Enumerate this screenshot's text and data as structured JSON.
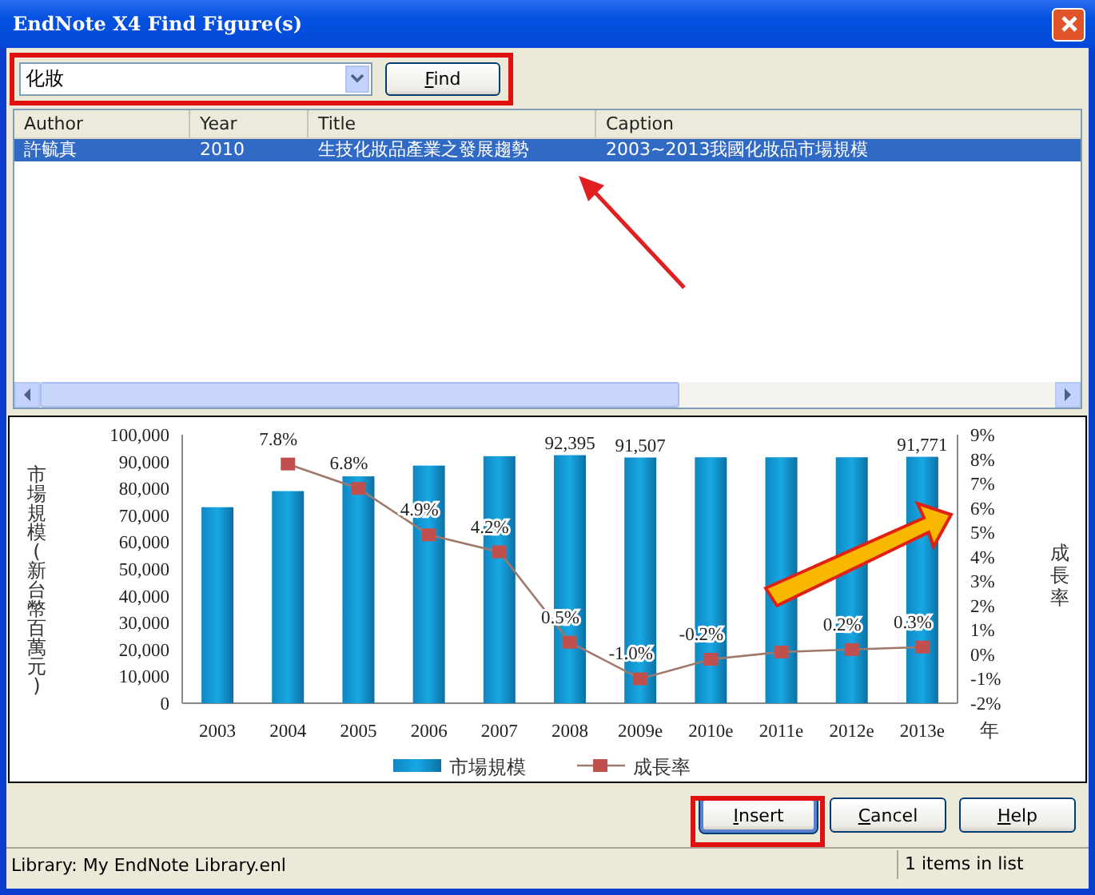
{
  "window": {
    "title": "EndNote X4 Find Figure(s)"
  },
  "search": {
    "value": "化妝",
    "button": "Find"
  },
  "results": {
    "columns": [
      "Author",
      "Year",
      "Title",
      "Caption"
    ],
    "rows": [
      {
        "cells": [
          "許毓真",
          "2010",
          "生技化妝品產業之發展趨勢",
          "2003~2013我國化妝品市場規模"
        ],
        "selected": true
      }
    ]
  },
  "preview": {
    "chart_data": {
      "type": "bar",
      "xlabel": "年",
      "ylabel": "市場規模(新台幣百萬元)",
      "categories": [
        "2003",
        "2004",
        "2005",
        "2006",
        "2007",
        "2008",
        "2009e",
        "2010e",
        "2011e",
        "2012e",
        "2013e"
      ],
      "series": [
        {
          "name": "市場規模",
          "color": "#18a8e4",
          "values": [
            73000,
            79000,
            84500,
            88500,
            92000,
            92395,
            91507,
            91600,
            91600,
            91600,
            91771
          ]
        }
      ],
      "value_labels": [
        null,
        null,
        null,
        null,
        null,
        "92,395",
        "91,507",
        null,
        null,
        null,
        "91,771"
      ],
      "ylim": [
        0,
        100000
      ],
      "yticks": [
        {
          "value": 0,
          "label": "0"
        },
        {
          "value": 10000,
          "label": "10,000"
        },
        {
          "value": 20000,
          "label": "20,000"
        },
        {
          "value": 30000,
          "label": "30,000"
        },
        {
          "value": 40000,
          "label": "40,000"
        },
        {
          "value": 50000,
          "label": "50,000"
        },
        {
          "value": 60000,
          "label": "60,000"
        },
        {
          "value": 70000,
          "label": "70,000"
        },
        {
          "value": 80000,
          "label": "80,000"
        },
        {
          "value": 90000,
          "label": "90,000"
        },
        {
          "value": 100000,
          "label": "100,000"
        }
      ]
    },
    "growth": {
      "chart_data": {
        "type": "line",
        "ylabel": "成長率",
        "categories": [
          null,
          null,
          null,
          null,
          null,
          null,
          null,
          null,
          null,
          null,
          null
        ],
        "series": [
          {
            "name": "成長率",
            "color": "#c0504d",
            "marker": "square",
            "values": [
              null,
              7.8,
              6.8,
              4.9,
              4.2,
              0.5,
              -1.0,
              -0.2,
              0.1,
              0.2,
              0.3
            ]
          }
        ],
        "ylim": [
          -2,
          9
        ],
        "yticks": [
          {
            "value": -2,
            "label": "-2%"
          },
          {
            "value": -1,
            "label": "-1%"
          },
          {
            "value": 0,
            "label": "0%"
          },
          {
            "value": 1,
            "label": "1%"
          },
          {
            "value": 2,
            "label": "2%"
          },
          {
            "value": 3,
            "label": "3%"
          },
          {
            "value": 4,
            "label": "4%"
          },
          {
            "value": 5,
            "label": "5%"
          },
          {
            "value": 6,
            "label": "6%"
          },
          {
            "value": 7,
            "label": "7%"
          },
          {
            "value": 8,
            "label": "8%"
          },
          {
            "value": 9,
            "label": "9%"
          }
        ],
        "value_labels": [
          null,
          "7.8%",
          "6.8%",
          "4.9%",
          "4.2%",
          "0.5%",
          "-1.0%",
          "-0.2%",
          null,
          "0.2%",
          "0.3%"
        ]
      }
    }
  },
  "buttons": [
    {
      "label": "Insert",
      "default": true
    },
    {
      "label": "Cancel",
      "default": false
    },
    {
      "label": "Help",
      "default": false
    }
  ],
  "status_bar": {
    "library": "Library: My EndNote Library.enl",
    "count": "1 items in list"
  }
}
